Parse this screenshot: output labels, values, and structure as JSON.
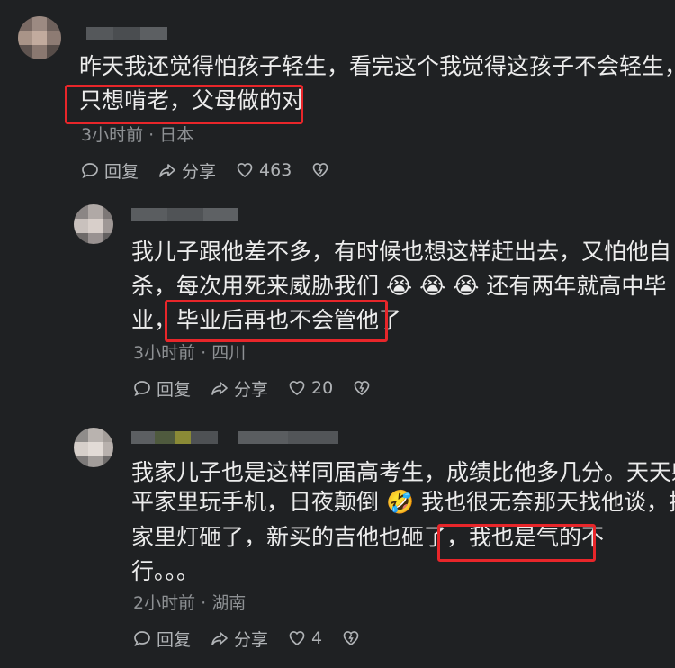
{
  "comments": [
    {
      "lines": [
        "昨天我还觉得怕孩子轻生，看完这个我觉得这孩子不会轻生，",
        "只想啃老，父母做的对"
      ],
      "meta": "3小时前 · 日本",
      "reply_label": "回复",
      "share_label": "分享",
      "like_count": "463"
    },
    {
      "lines": [
        "我儿子跟他差不多，有时候也想这样赶出去，又怕他自",
        "杀，每次用死来威胁我们 😭 😭 😭 还有两年就高中毕",
        "业，毕业后再也不会管他了"
      ],
      "meta": "3小时前 · 四川",
      "reply_label": "回复",
      "share_label": "分享",
      "like_count": "20"
    },
    {
      "lines": [
        "我家儿子也是这样同届高考生，成绩比他多几分。天天躺",
        "平家里玩手机，日夜颠倒 🤣 我也很无奈那天找他谈，把",
        "家里灯砸了，新买的吉他也砸了，我也是气的不",
        "行。。。"
      ],
      "meta": "2小时前 · 湖南",
      "reply_label": "回复",
      "share_label": "分享",
      "like_count": "4"
    }
  ],
  "colors": {
    "highlight": "#e8262a",
    "background": "#1f2123"
  },
  "icons": [
    "reply-icon",
    "share-icon",
    "heart-icon",
    "dislike-icon"
  ]
}
